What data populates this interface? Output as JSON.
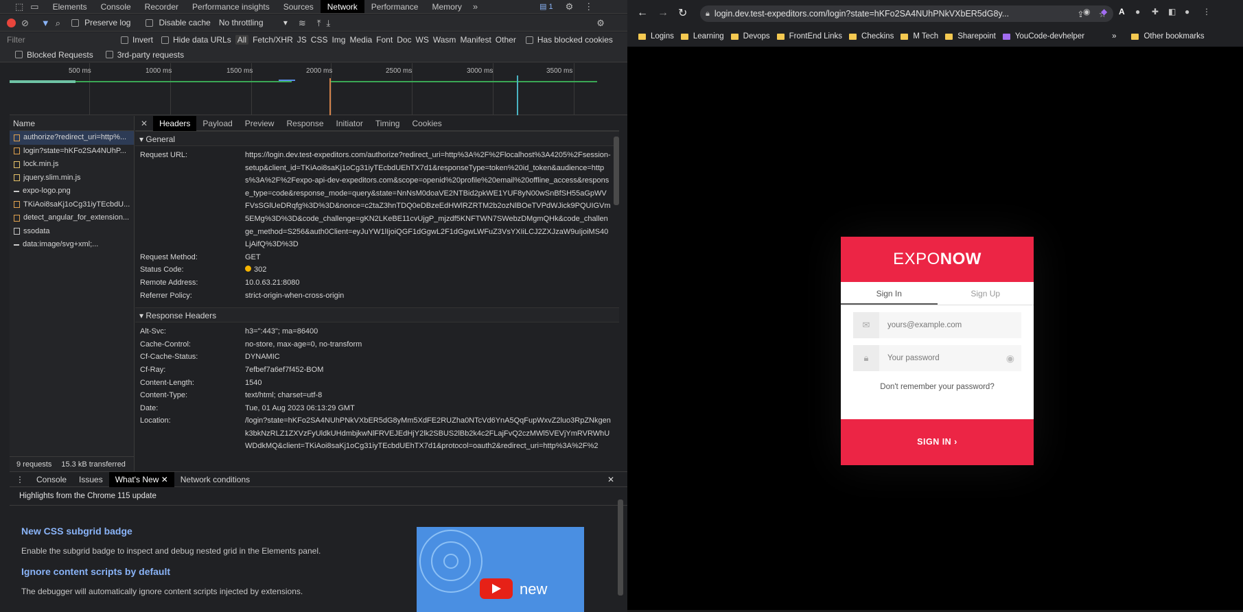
{
  "devtools": {
    "tabs": [
      "Elements",
      "Console",
      "Recorder",
      "Performance insights",
      "Sources",
      "Network",
      "Performance",
      "Memory"
    ],
    "active_tab": "Network",
    "issues_count": "1",
    "toolbar": {
      "preserve_log": "Preserve log",
      "disable_cache": "Disable cache",
      "throttling": "No throttling"
    },
    "filter": {
      "placeholder": "Filter",
      "invert": "Invert",
      "hide_data_urls": "Hide data URLs",
      "types": [
        "All",
        "Fetch/XHR",
        "JS",
        "CSS",
        "Img",
        "Media",
        "Font",
        "Doc",
        "WS",
        "Wasm",
        "Manifest",
        "Other"
      ],
      "has_blocked_cookies": "Has blocked cookies",
      "blocked_requests": "Blocked Requests",
      "third_party": "3rd-party requests"
    },
    "timeline_ticks": [
      "500 ms",
      "1000 ms",
      "1500 ms",
      "2000 ms",
      "2500 ms",
      "3000 ms",
      "3500 ms"
    ],
    "name_header": "Name",
    "requests": [
      {
        "name": "authorize?redirect_uri=http%...",
        "icon": "doc"
      },
      {
        "name": "login?state=hKFo2SA4NUhP...",
        "icon": "doc"
      },
      {
        "name": "lock.min.js",
        "icon": "js"
      },
      {
        "name": "jquery.slim.min.js",
        "icon": "js"
      },
      {
        "name": "expo-logo.png",
        "icon": "img"
      },
      {
        "name": "TKiAoi8saKj1oCg31iyTEcbdU...",
        "icon": "doc"
      },
      {
        "name": "detect_angular_for_extension...",
        "icon": "doc"
      },
      {
        "name": "ssodata",
        "icon": "plain"
      },
      {
        "name": "data:image/svg+xml;...",
        "icon": "img"
      }
    ],
    "summary": {
      "requests": "9 requests",
      "transferred": "15.3 kB transferred"
    },
    "detail_tabs": [
      "Headers",
      "Payload",
      "Preview",
      "Response",
      "Initiator",
      "Timing",
      "Cookies"
    ],
    "general": {
      "title": "General",
      "request_url_label": "Request URL:",
      "request_url": "https://login.dev.test-expeditors.com/authorize?redirect_uri=http%3A%2F%2Flocalhost%3A4205%2Fsession-setup&client_id=TKiAoi8saKj1oCg31iyTEcbdUEhTX7d1&responseType=token%20id_token&audience=https%3A%2F%2Fexpo-api-dev-expeditors.com&scope=openid%20profile%20email%20offline_access&response_type=code&response_mode=query&state=NnNsM0doaVE2NTBid2pkWE1YUF8yN00wSnBfSH55aGpWVFVsSGlUeDRqfg%3D%3D&nonce=c2taZ3hnTDQ0eDBzeEdHWlRZRTM2b2ozNlBOeTVPdWJick9PQUIGVm5EMg%3D%3D&code_challenge=gKN2LKeBE11cvUjgP_mjzdf5KNFTWN7SWebzDMgmQHk&code_challenge_method=S256&auth0Client=eyJuYW1lIjoiQGF1dGgwL2F1dGgwLWFuZ3VsYXIiLCJ2ZXJzaW9uIjoiMS40LjAifQ%3D%3D",
      "rows": [
        {
          "k": "Request Method:",
          "v": "GET"
        },
        {
          "k": "Status Code:",
          "v": "302"
        },
        {
          "k": "Remote Address:",
          "v": "10.0.63.21:8080"
        },
        {
          "k": "Referrer Policy:",
          "v": "strict-origin-when-cross-origin"
        }
      ]
    },
    "response_headers": {
      "title": "Response Headers",
      "rows": [
        {
          "k": "Alt-Svc:",
          "v": "h3=\":443\"; ma=86400"
        },
        {
          "k": "Cache-Control:",
          "v": "no-store, max-age=0, no-transform"
        },
        {
          "k": "Cf-Cache-Status:",
          "v": "DYNAMIC"
        },
        {
          "k": "Cf-Ray:",
          "v": "7efbef7a6ef7f452-BOM"
        },
        {
          "k": "Content-Length:",
          "v": "1540"
        },
        {
          "k": "Content-Type:",
          "v": "text/html; charset=utf-8"
        },
        {
          "k": "Date:",
          "v": "Tue, 01 Aug 2023 06:13:29 GMT"
        },
        {
          "k": "Location:",
          "v": "/login?state=hKFo2SA4NUhPNkVXbER5dG8yMm5XdFE2RUZha0NTcVd6YnA5QqFupWxvZ2luo3RpZNkgenk3bkNzRLZ1ZXVzFyUldkUHdmbjkwNlFRVEJEdHjY2lk2SBUS2lBb2k4c2FLajFvQ2czMWl5VEVjYmRVRWhUWDdkMQ&client=TKiAoi8saKj1oCg31iyTEcbdUEhTX7d1&protocol=oauth2&redirect_uri=http%3A%2F%2"
        }
      ]
    },
    "drawer": {
      "tabs": [
        "Console",
        "Issues",
        "What's New",
        "Network conditions"
      ],
      "active": "What's New",
      "highlight": "Highlights from the Chrome 115 update",
      "items": [
        {
          "title": "New CSS subgrid badge",
          "desc": "Enable the subgrid badge to inspect and debug nested grid in the Elements panel."
        },
        {
          "title": "Ignore content scripts by default",
          "desc": "The debugger will automatically ignore content scripts injected by extensions."
        }
      ],
      "thumb_text": "new"
    }
  },
  "browser": {
    "url": "login.dev.test-expeditors.com/login?state=hKFo2SA4NUhPNkVXbER5dG8y...",
    "bookmarks": [
      "Logins",
      "Learning",
      "Devops",
      "FrontEnd Links",
      "Checkins",
      "M Tech",
      "Sharepoint",
      "YouCode-devhelper"
    ],
    "other_bookmarks": "Other bookmarks",
    "login": {
      "brand_light": "EXPO",
      "brand_bold": "NOW",
      "tab_signin": "Sign In",
      "tab_signup": "Sign Up",
      "email_placeholder": "yours@example.com",
      "password_placeholder": "Your password",
      "forgot": "Don't remember your password?",
      "submit": "SIGN IN ›"
    }
  },
  "colors": {
    "accent": "#ec2545",
    "devtools_bg": "#202124",
    "selected_row": "#2d3b55"
  }
}
